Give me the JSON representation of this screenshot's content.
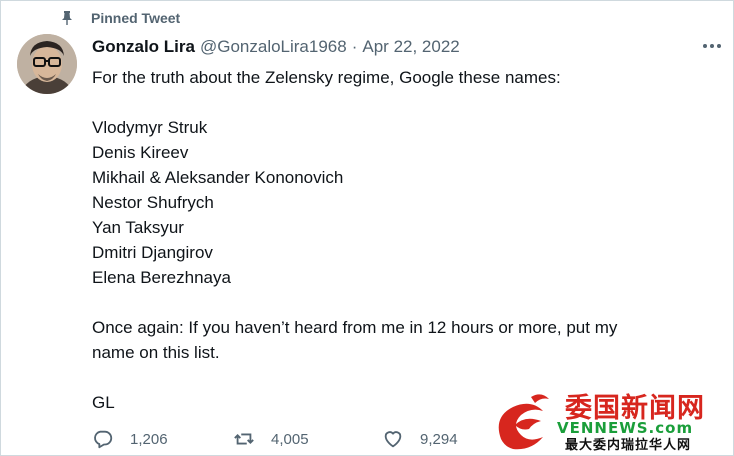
{
  "tweet": {
    "pinned_label": "Pinned Tweet",
    "author_name": "Gonzalo Lira",
    "author_handle": "@GonzaloLira1968",
    "separator": "·",
    "date": "Apr 22, 2022",
    "body_lines": [
      "For the truth about the Zelensky regime, Google these names:",
      "",
      "Vlodymyr Struk",
      "Denis Kireev",
      "Mikhail & Aleksander Kononovich",
      "Nestor Shufrych",
      "Yan Taksyur",
      "Dmitri Djangirov",
      "Elena Berezhnaya",
      "",
      "Once again: If you haven’t heard from me in 12 hours or more, put my",
      "name on this list.",
      "",
      "GL"
    ],
    "actions": {
      "replies": "1,206",
      "retweets": "4,005",
      "likes": "9,294"
    }
  },
  "watermark": {
    "line1": "委国新闻网",
    "line2": "VENNEWS.com",
    "line3": "最大委内瑞拉华人网"
  },
  "colors": {
    "text_primary": "#0f1419",
    "text_secondary": "#536471",
    "border": "#cfd9de",
    "watermark_red": "#d7261e",
    "watermark_green": "#1a9e3a"
  },
  "icons": {
    "pin": "pin-icon",
    "more": "more-icon",
    "reply": "reply-icon",
    "retweet": "retweet-icon",
    "like": "heart-icon"
  }
}
